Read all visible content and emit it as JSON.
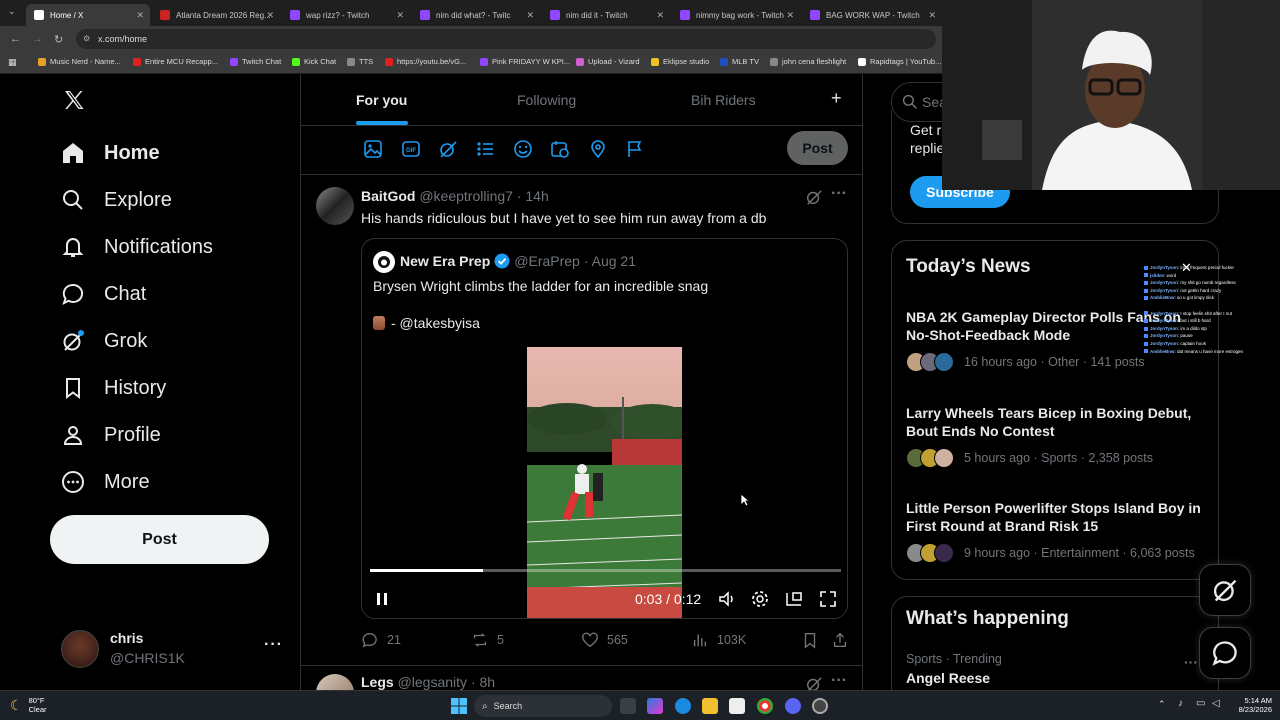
{
  "browser": {
    "tabs": [
      {
        "label": "Home / X",
        "color": "#ffffff"
      },
      {
        "label": "Atlanta Dream 2026 Reg...",
        "color": "#cc2222"
      },
      {
        "label": "wap rizz? - Twitch",
        "color": "#9146ff"
      },
      {
        "label": "nim did what? - Twitc",
        "color": "#9146ff"
      },
      {
        "label": "nim did it - Twitch",
        "color": "#9146ff"
      },
      {
        "label": "nimmy bag work - Twitch",
        "color": "#9146ff"
      },
      {
        "label": "BAG WORK WAP - Twitch",
        "color": "#9146ff"
      }
    ],
    "url": "x.com/home",
    "bookmarks": [
      {
        "label": "Music Nerd - Name...",
        "color": "#e8a02a"
      },
      {
        "label": "Entire MCU Recapp...",
        "color": "#e02020"
      },
      {
        "label": "Twitch Chat",
        "color": "#9146ff"
      },
      {
        "label": "Kick Chat",
        "color": "#53fc18"
      },
      {
        "label": "TTS",
        "color": "#888888"
      },
      {
        "label": "https://youtu.be/vG...",
        "color": "#e02020"
      },
      {
        "label": "Pink FRIDAYY W KPI...",
        "color": "#9146ff"
      },
      {
        "label": "Upload - Vizard",
        "color": "#d060d0"
      },
      {
        "label": "Eklipse studio",
        "color": "#f0c020"
      },
      {
        "label": "MLB TV",
        "color": "#2050c0"
      },
      {
        "label": "john cena fleshlight",
        "color": "#888888"
      },
      {
        "label": "Rapidtags | YouTub...",
        "color": "#ffffff"
      }
    ]
  },
  "nav": {
    "items": [
      {
        "label": "Home",
        "icon": "home-icon"
      },
      {
        "label": "Explore",
        "icon": "search-icon"
      },
      {
        "label": "Notifications",
        "icon": "bell-icon"
      },
      {
        "label": "Chat",
        "icon": "chat-icon"
      },
      {
        "label": "Grok",
        "icon": "grok-icon"
      },
      {
        "label": "History",
        "icon": "bookmark-icon"
      },
      {
        "label": "Profile",
        "icon": "person-icon"
      },
      {
        "label": "More",
        "icon": "more-circle-icon"
      }
    ],
    "post_label": "Post",
    "account": {
      "name": "chris",
      "handle": "@CHRIS1K"
    }
  },
  "feed": {
    "tabs": [
      "For you",
      "Following",
      "Bih Riders"
    ],
    "composer_post_label": "Post",
    "tweet1": {
      "name": "BaitGod",
      "handle": "@keeptrolling7",
      "time": "· 14h",
      "text": "His hands ridiculous but I have yet to see him run away from a db",
      "quote": {
        "name": "New Era Prep",
        "handle": "@EraPrep",
        "time": "· Aug 21",
        "text": "Brysen Wright climbs the ladder for an incredible snag",
        "credit": "- @takesbyisa",
        "video_time": "0:03 / 0:12",
        "video_progress": 0.24
      },
      "stats": {
        "replies": "21",
        "reposts": "5",
        "likes": "565",
        "views": "103K"
      }
    },
    "tweet2": {
      "name": "Legs",
      "handle": "@legsanity",
      "time": "· 8h"
    }
  },
  "right": {
    "search_placeholder": "Sea",
    "premium_text_1": "Get r",
    "premium_text_2": "replie",
    "subscribe_label": "Subscribe",
    "news_title": "Today’s News",
    "news": [
      {
        "title": "NBA 2K Gameplay Director Polls Fans on No-Shot-Feedback Mode",
        "meta": "16 hours ago · Other · 141 posts"
      },
      {
        "title": "Larry Wheels Tears Bicep in Boxing Debut, Bout Ends No Contest",
        "meta": "5 hours ago · Sports · 2,358 posts"
      },
      {
        "title": "Little Person Powerlifter Stops Island Boy in First Round at Brand Risk 15",
        "meta": "9 hours ago · Entertainment · 6,063 posts"
      }
    ],
    "happening_title": "What’s happening",
    "trend_meta": "Sports · Trending",
    "trend_name": "Angel Reese"
  },
  "chat_overlay": [
    {
      "user": "JordynTyson",
      "msg": ": im a frequent period fucker"
    },
    {
      "user": "jslides",
      "msg": ": word"
    },
    {
      "user": "JordynTyson",
      "msg": ": my shit go numb regardless"
    },
    {
      "user": "JordynTyson",
      "msg": ": not gettin hard crazy"
    },
    {
      "user": "AmblieBnw",
      "msg": ": so u got limpy dick"
    },
    {
      "user": "",
      "msg": ""
    },
    {
      "user": "JordynTyson",
      "msg": ": I stop feelin shit after I nut"
    },
    {
      "user": "JordynTyson",
      "msg": ": but i still b hard"
    },
    {
      "user": "JordynTyson",
      "msg": ": im a dildo stp"
    },
    {
      "user": "JordynTyson",
      "msg": ": pause"
    },
    {
      "user": "JordynTyson",
      "msg": ": captain hook"
    },
    {
      "user": "AmblieBnw",
      "msg": ": dat means u have more estrogen"
    }
  ],
  "taskbar": {
    "weather_temp": "80°F",
    "weather_desc": "Clear",
    "search_label": "Search",
    "time": "5:14 AM",
    "date": "8/23/2026"
  }
}
